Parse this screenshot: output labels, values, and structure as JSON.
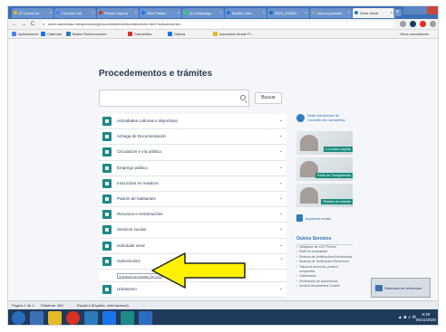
{
  "browser": {
    "tabs": [
      {
        "label": "El Correo es",
        "color": "#e5ba29"
      },
      {
        "label": "Chrome noti",
        "color": "#4285f4"
      },
      {
        "label": "Portal Carpeta",
        "color": "#d93025"
      },
      {
        "label": "Ofici Pleabo",
        "color": "#1a73e8"
      },
      {
        "label": "(1) WhatsApp",
        "color": "#25d366"
      },
      {
        "label": "Boletín Ofici",
        "color": "#1a73e8"
      },
      {
        "label": "2020_000060",
        "color": "#2a6dbf"
      },
      {
        "label": "Nueva pestaña",
        "color": "#9aa0a6"
      },
      {
        "label": "Sede electr",
        "color": "#2b7bbd"
      }
    ],
    "new_tab_label": "+",
    "url": "sede.camarinas.net/opencms/gl/procedimientos/tramites/index.html?subsecciones",
    "back_label": "←",
    "forward_label": "→",
    "reload_label": "C",
    "bookmarks": [
      {
        "label": "Aplicaciones",
        "color": "#4285f4"
      },
      {
        "label": "Calendar",
        "color": "#1a73e8"
      },
      {
        "label": "Bases Subvenciones",
        "color": "#2b7bbd"
      },
      {
        "label": "Camariñas",
        "color": "#d93025"
      },
      {
        "label": "Galicia",
        "color": "#1a73e8"
      },
      {
        "label": "Importado desde Fi...",
        "color": "#e5ba29"
      }
    ],
    "other_bookmarks": "Otros marcadores"
  },
  "page": {
    "title": "Procedementos e trámites",
    "search": {
      "value": "",
      "placeholder": "",
      "button_label": "Buscar"
    },
    "categories": [
      {
        "label": "Actividades culturais e deportivas"
      },
      {
        "label": "Achega de Documentación"
      },
      {
        "label": "Circulación e vía pública"
      },
      {
        "label": "Emprego público"
      },
      {
        "label": "Inscricións en rexistros"
      },
      {
        "label": "Padrón de habitantes"
      },
      {
        "label": "Recursos e reclamacións"
      },
      {
        "label": "Servizos sociais"
      },
      {
        "label": "Solicitude xeral"
      },
      {
        "label": "Subvencións"
      },
      {
        "label": "Urbanismo"
      }
    ],
    "expanded_category_index": 9,
    "sub_link_label": "Solicitude de axudas FAC 2020",
    "chevron_down": "⌄",
    "chevron_up": "^"
  },
  "sidebar": {
    "sede_text": "Sede electrónica do Concello de Camariñas",
    "banners": [
      {
        "label": "Ir á nobre carpeta"
      },
      {
        "label": "Portal de Transparencia"
      },
      {
        "label": "Rexistro de entrada"
      }
    ],
    "impresos_label": "Impresos xerais",
    "otros_title": "Outros Servizos",
    "otros": [
      "Validación de CSV Pernos",
      "Perfil do contratante",
      "Sistema de Notificacións Electrónicas",
      "Sistema de Verificación Electrónica",
      "Taboa de anuncios, portal e compartida",
      "Calendarios",
      "Verificación de documentos",
      "Xestión Documentos Contrib"
    ]
  },
  "status": {
    "page": "Página 1 de 1",
    "words": "Palabras: 484",
    "language": "Español (España, internacional)"
  },
  "preview_label": "Sistemas de referencia",
  "clock": {
    "time": "9:29",
    "date": "05/11/2020"
  },
  "colors": {
    "teal": "#1d8a87",
    "brand_blue": "#2b6fb3",
    "arrow_yellow": "#fff200"
  }
}
